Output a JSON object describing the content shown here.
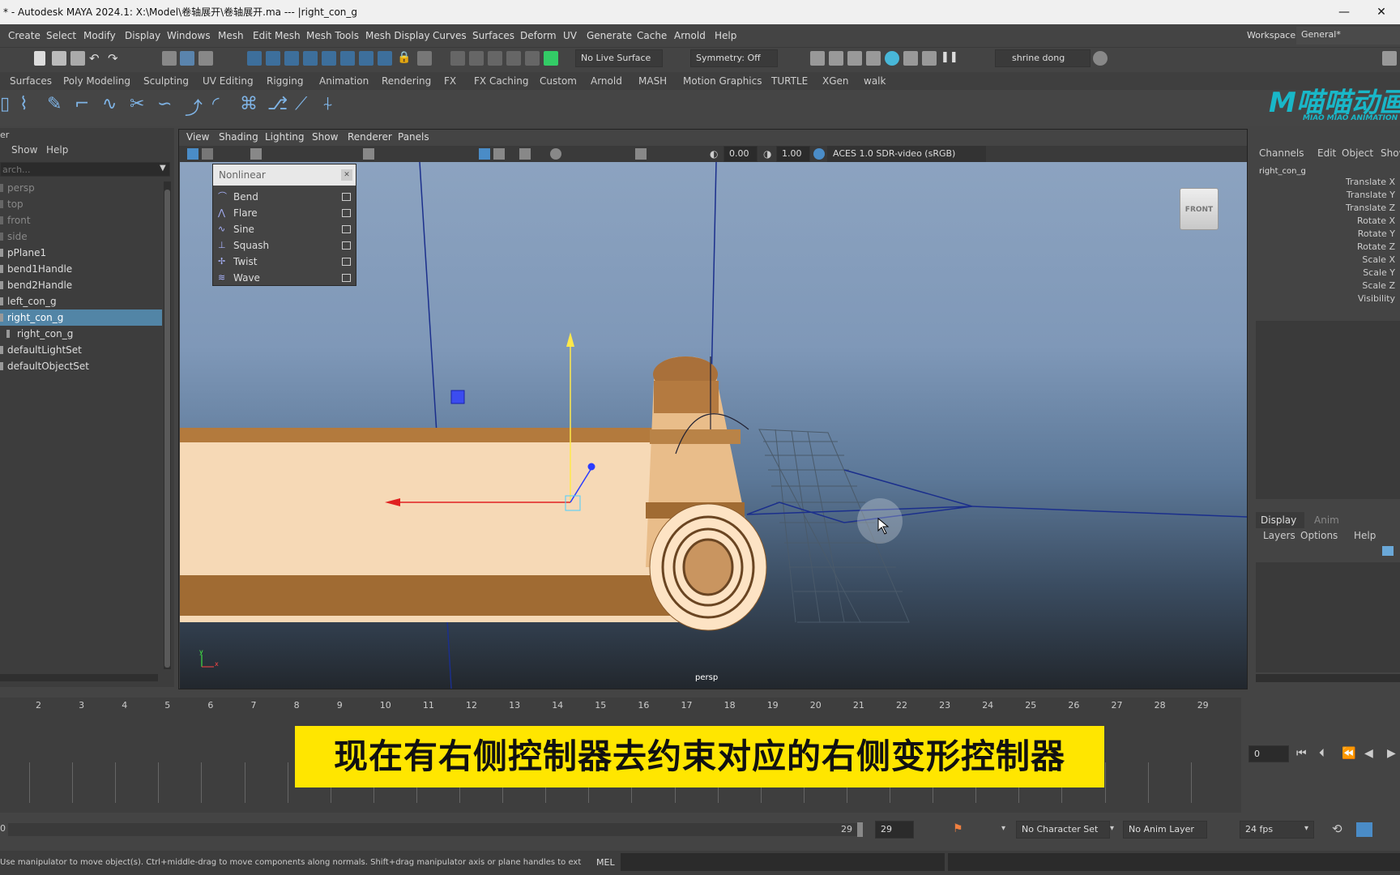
{
  "window": {
    "title": "* - Autodesk MAYA 2024.1: X:\\Model\\卷轴展开\\卷轴展开.ma  ---  |right_con_g",
    "close_glyph": "✕",
    "minimize_glyph": "—"
  },
  "menus": [
    "Create",
    "Select",
    "Modify",
    "Display",
    "Windows",
    "Mesh",
    "Edit Mesh",
    "Mesh Tools",
    "Mesh Display",
    "Curves",
    "Surfaces",
    "Deform",
    "UV",
    "Generate",
    "Cache",
    "Arnold",
    "Help"
  ],
  "workspace": {
    "label": "Workspace:",
    "value": "General*"
  },
  "statusline": {
    "live_surface": "No Live Surface",
    "symmetry": "Symmetry: Off",
    "user": "shrine dong"
  },
  "shelf_tabs": [
    "Surfaces",
    "Poly Modeling",
    "Sculpting",
    "UV Editing",
    "Rigging",
    "Animation",
    "Rendering",
    "FX",
    "FX Caching",
    "Custom",
    "Arnold",
    "MASH",
    "Motion Graphics",
    "TURTLE",
    "XGen",
    "walk"
  ],
  "logo": {
    "main": "M喵喵动画",
    "sub": "MIAO MIAO ANIMATION"
  },
  "outliner": {
    "title": "er",
    "menus": [
      "Show",
      "Help"
    ],
    "search_placeholder": "arch...",
    "items": [
      {
        "label": "persp",
        "dim": true
      },
      {
        "label": "top",
        "dim": true
      },
      {
        "label": "front",
        "dim": true
      },
      {
        "label": "side",
        "dim": true
      },
      {
        "label": "pPlane1",
        "dim": false
      },
      {
        "label": "bend1Handle",
        "dim": false
      },
      {
        "label": "bend2Handle",
        "dim": false
      },
      {
        "label": "left_con_g",
        "dim": false
      },
      {
        "label": "right_con_g",
        "dim": false,
        "selected": true
      },
      {
        "label": "right_con_g",
        "dim": false,
        "child": true
      },
      {
        "label": "defaultLightSet",
        "dim": false
      },
      {
        "label": "defaultObjectSet",
        "dim": false
      }
    ]
  },
  "viewport": {
    "menus": [
      "View",
      "Shading",
      "Lighting",
      "Show",
      "Renderer",
      "Panels"
    ],
    "exposure": "0.00",
    "gamma": "1.00",
    "color_space": "ACES 1.0 SDR-video (sRGB)",
    "camera_label": "persp",
    "viewcube_label": "FRONT"
  },
  "nonlinear_menu": {
    "title": "Nonlinear",
    "items": [
      "Bend",
      "Flare",
      "Sine",
      "Squash",
      "Twist",
      "Wave"
    ]
  },
  "channel_box": {
    "menus": [
      "Channels",
      "Edit",
      "Object",
      "Show"
    ],
    "object": "right_con_g",
    "attributes": [
      "Translate X",
      "Translate Y",
      "Translate Z",
      "Rotate X",
      "Rotate Y",
      "Rotate Z",
      "Scale X",
      "Scale Y",
      "Scale Z",
      "Visibility"
    ]
  },
  "layer_editor": {
    "tabs": [
      "Display",
      "Anim"
    ],
    "menus": [
      "Layers",
      "Options",
      "Help"
    ]
  },
  "timeline": {
    "ticks": [
      "2",
      "3",
      "4",
      "5",
      "6",
      "7",
      "8",
      "9",
      "10",
      "11",
      "12",
      "13",
      "14",
      "15",
      "16",
      "17",
      "18",
      "19",
      "20",
      "21",
      "22",
      "23",
      "24",
      "25",
      "26",
      "27",
      "28",
      "29"
    ],
    "current_frame": "0"
  },
  "subtitle": "现在有右侧控制器去约束对应的右侧变形控制器",
  "range": {
    "start": "0",
    "end_a": "29",
    "end_b": "29",
    "character_set": "No Character Set",
    "anim_layer": "No Anim Layer",
    "fps": "24 fps"
  },
  "helpline": {
    "text": "Use manipulator to move object(s). Ctrl+middle-drag to move components along normals. Shift+drag manipulator axis or plane handles to extrude components or c",
    "mel_label": "MEL"
  }
}
